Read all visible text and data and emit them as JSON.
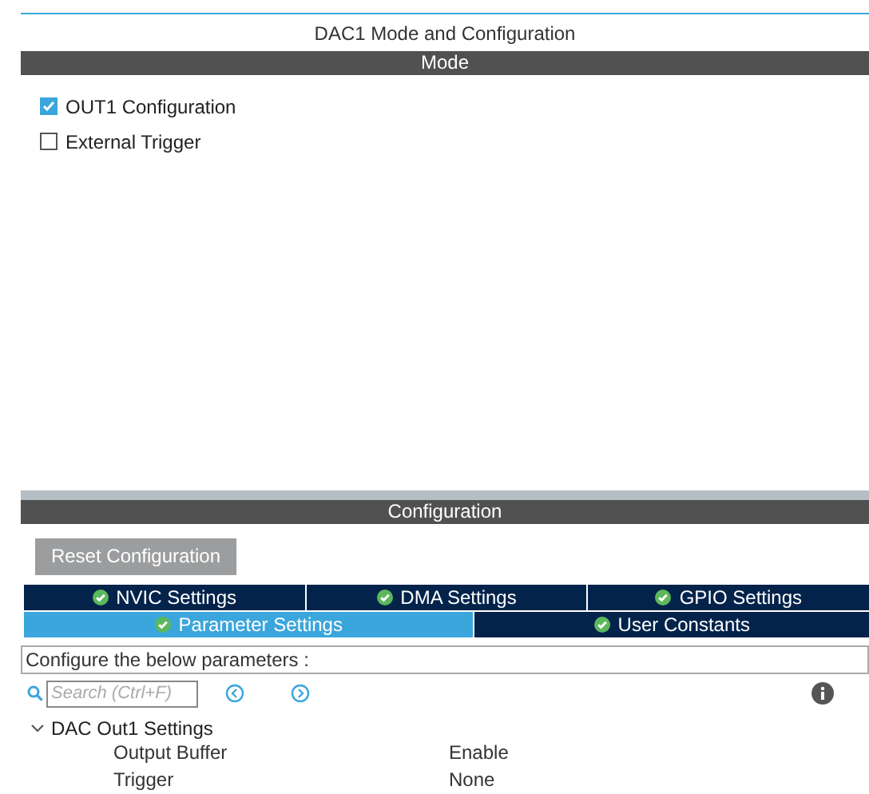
{
  "title": "DAC1 Mode and Configuration",
  "mode": {
    "header": "Mode",
    "options": [
      {
        "label": "OUT1 Configuration",
        "checked": true
      },
      {
        "label": "External Trigger",
        "checked": false
      }
    ]
  },
  "configuration": {
    "header": "Configuration",
    "reset_button": "Reset Configuration",
    "tab_rows": [
      [
        {
          "label": "NVIC Settings",
          "selected": false
        },
        {
          "label": "DMA Settings",
          "selected": false
        },
        {
          "label": "GPIO Settings",
          "selected": false
        }
      ],
      [
        {
          "label": "Parameter Settings",
          "selected": true
        },
        {
          "label": "User Constants",
          "selected": false
        }
      ]
    ],
    "description": "Configure the below parameters :",
    "search": {
      "placeholder": "Search (Ctrl+F)"
    },
    "tree": [
      {
        "label": "DAC Out1 Settings",
        "expanded": true,
        "children": [
          {
            "name": "Output Buffer",
            "value": "Enable"
          },
          {
            "name": "Trigger",
            "value": "None"
          }
        ]
      }
    ]
  }
}
